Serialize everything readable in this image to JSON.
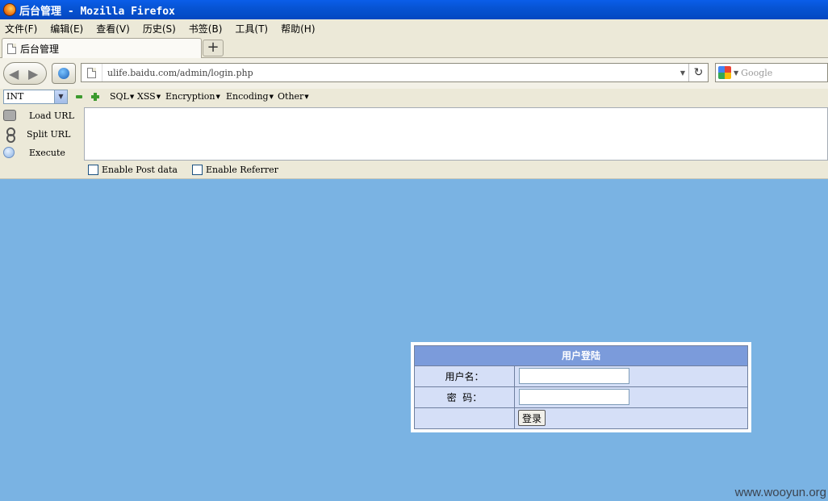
{
  "window": {
    "title": "后台管理 - Mozilla Firefox"
  },
  "menubar": {
    "items": [
      "文件(F)",
      "编辑(E)",
      "查看(V)",
      "历史(S)",
      "书签(B)",
      "工具(T)",
      "帮助(H)"
    ]
  },
  "tabs": [
    {
      "label": "后台管理"
    }
  ],
  "newtab": {
    "label": "+"
  },
  "navbar": {
    "url": "ulife.baidu.com/admin/login.php",
    "search_placeholder": "Google"
  },
  "hackbar": {
    "type_select": "INT",
    "menus": [
      "SQL",
      "XSS",
      "Encryption",
      "Encoding",
      "Other"
    ],
    "actions": [
      "Load URL",
      "Split URL",
      "Execute"
    ],
    "options": [
      "Enable Post data",
      "Enable Referrer"
    ]
  },
  "login": {
    "title": "用户登陆",
    "username_label": "用户名：",
    "password_label": "密  码：",
    "submit_label": "登录",
    "username_value": "",
    "password_value": ""
  },
  "watermark": "www.wooyun.org",
  "colors": {
    "page_bg": "#7ab3e3",
    "titlebar": "#0754d4",
    "login_header": "#7b9bdb",
    "login_body": "#d5dff7"
  }
}
